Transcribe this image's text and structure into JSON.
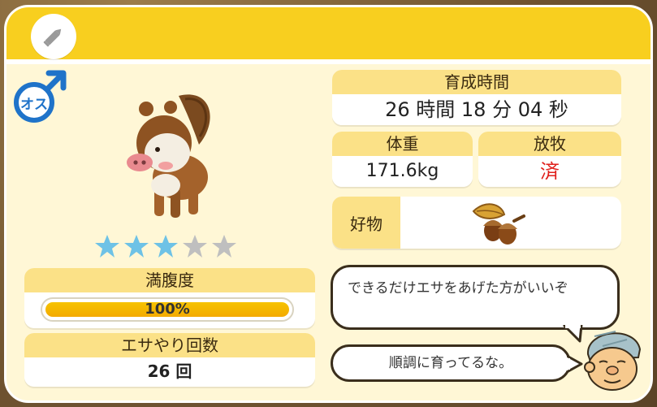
{
  "header": {
    "edit_icon": "pencil-icon"
  },
  "animal": {
    "gender_label": "オス",
    "gender_icon": "male-icon",
    "rating": 3,
    "rating_max": 5,
    "colors": {
      "star_on": "#6ec2e6",
      "star_off": "#bfbfbf"
    }
  },
  "stats": {
    "fullness_label": "満腹度",
    "fullness_value": "100%",
    "fullness_fraction": 1.0,
    "feed_count_label": "エサやり回数",
    "feed_count_value": "26 回",
    "raising_time_label": "育成時間",
    "raising_time_value": "26 時間 18 分 04 秒",
    "weight_label": "体重",
    "weight_value": "171.6kg",
    "grazing_label": "放牧",
    "grazing_value": "済",
    "favorite_label": "好物",
    "favorite_icon": "acorn-icon"
  },
  "dialog": {
    "hint": "できるだけエサをあげた方がいいぞ",
    "status": "順調に育ってるな。"
  },
  "colors": {
    "header": "#f8cf1f",
    "panel_label": "#fbe187",
    "accent_red": "#e0201c",
    "male_blue": "#1f73c9"
  }
}
